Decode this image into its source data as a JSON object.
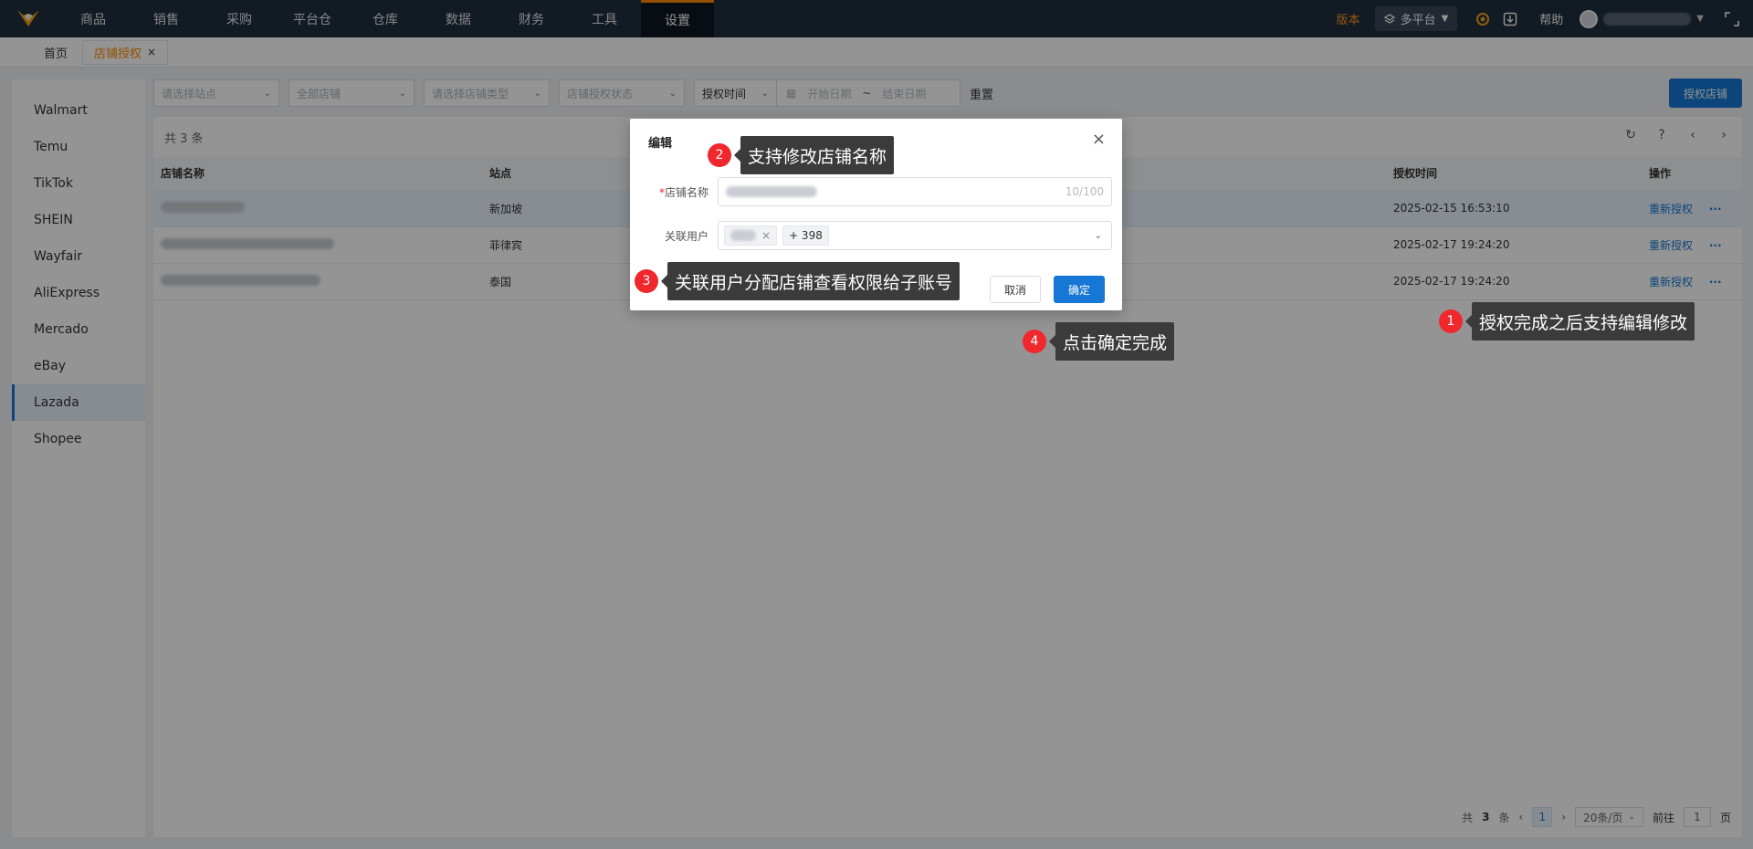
{
  "nav": {
    "items": [
      "商品",
      "销售",
      "采购",
      "平台仓",
      "仓库",
      "数据",
      "财务",
      "工具",
      "设置"
    ],
    "version_label": "版本",
    "platform_label": "多平台",
    "help_label": "帮助"
  },
  "tabs": [
    {
      "label": "首页"
    },
    {
      "label": "店铺授权",
      "close": "×"
    }
  ],
  "sidebar": {
    "items": [
      "Walmart",
      "Temu",
      "TikTok",
      "SHEIN",
      "Wayfair",
      "AliExpress",
      "Mercado",
      "eBay",
      "Lazada",
      "Shopee"
    ],
    "active": "Lazada"
  },
  "filters": {
    "site_placeholder": "请选择站点",
    "shop_value": "全部店铺",
    "shop_type_placeholder": "请选择店铺类型",
    "auth_status_placeholder": "店铺授权状态",
    "date_type": "授权时间",
    "start_placeholder": "开始日期",
    "range_sep": "~",
    "end_placeholder": "结束日期",
    "reset_label": "重置"
  },
  "auth_button_label": "授权店铺",
  "table": {
    "summary": "共 3 条",
    "columns": [
      "店铺名称",
      "站点",
      "授权时间",
      "操作"
    ],
    "rows": [
      {
        "site": "新加坡",
        "auth_time": "2025-02-15 16:53:10",
        "op": "重新授权",
        "more": "···"
      },
      {
        "site": "菲律宾",
        "auth_time": "2025-02-17 19:24:20",
        "op": "重新授权",
        "more": "···"
      },
      {
        "site": "泰国",
        "auth_time": "2025-02-17 19:24:20",
        "op": "重新授权",
        "more": "···"
      }
    ]
  },
  "pager": {
    "total_prefix": "共",
    "total": "3",
    "total_suffix": "条",
    "current_page": "1",
    "page_size": "20条/页",
    "goto_label": "前往",
    "goto_value": "1",
    "page_unit": "页"
  },
  "modal": {
    "title": "编辑",
    "close": "×",
    "name_label": "店铺名称",
    "name_required": "*",
    "name_count": "10/100",
    "users_label": "关联用户",
    "users_extra": "+ 398",
    "cancel_label": "取消",
    "ok_label": "确定"
  },
  "callouts": [
    {
      "num": "1",
      "text": "授权完成之后支持编辑修改"
    },
    {
      "num": "2",
      "text": "支持修改店铺名称"
    },
    {
      "num": "3",
      "text": "关联用户分配店铺查看权限给子账号"
    },
    {
      "num": "4",
      "text": "点击确定完成"
    }
  ],
  "colors": {
    "nav_bg": "#1f2d3d",
    "accent_orange": "#ff8a00",
    "primary_blue": "#1677d4",
    "badge_red": "#f0282d"
  }
}
